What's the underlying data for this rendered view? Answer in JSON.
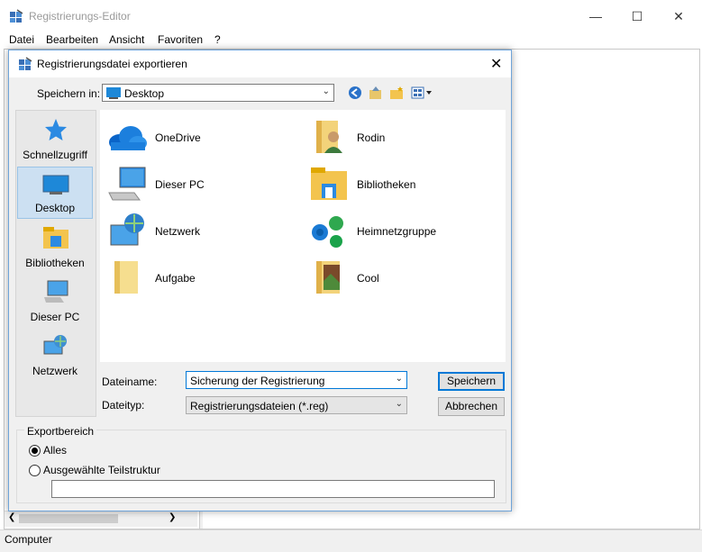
{
  "main": {
    "title": "Registrierungs-Editor",
    "menu": [
      "Datei",
      "Bearbeiten",
      "Ansicht",
      "Favoriten",
      "?"
    ],
    "status": "Computer"
  },
  "dialog": {
    "title": "Registrierungsdatei exportieren",
    "save_in_label": "Speichern in:",
    "save_in_value": "Desktop",
    "places": [
      {
        "label": "Schnellzugriff",
        "icon": "star-icon"
      },
      {
        "label": "Desktop",
        "icon": "desktop-icon"
      },
      {
        "label": "Bibliotheken",
        "icon": "libraries-icon"
      },
      {
        "label": "Dieser PC",
        "icon": "computer-icon"
      },
      {
        "label": "Netzwerk",
        "icon": "network-icon"
      }
    ],
    "files": [
      {
        "name": "OneDrive",
        "icon": "cloud-icon"
      },
      {
        "name": "Rodin",
        "icon": "user-folder-icon"
      },
      {
        "name": "Dieser PC",
        "icon": "computer-icon"
      },
      {
        "name": "Bibliotheken",
        "icon": "libraries-icon"
      },
      {
        "name": "Netzwerk",
        "icon": "network-icon"
      },
      {
        "name": "Heimnetzgruppe",
        "icon": "homegroup-icon"
      },
      {
        "name": "Aufgabe",
        "icon": "folder-icon"
      },
      {
        "name": "Cool",
        "icon": "picture-folder-icon"
      }
    ],
    "filename_label": "Dateiname:",
    "filename_value": "Sicherung der Registrierung",
    "filetype_label": "Dateityp:",
    "filetype_value": "Registrierungsdateien (*.reg)",
    "save_button": "Speichern",
    "cancel_button": "Abbrechen",
    "export_range_label": "Exportbereich",
    "radio_all": "Alles",
    "radio_branch": "Ausgewählte Teilstruktur",
    "branch_value": ""
  },
  "colors": {
    "accent": "#0078d7",
    "selection": "#cce0f2"
  }
}
